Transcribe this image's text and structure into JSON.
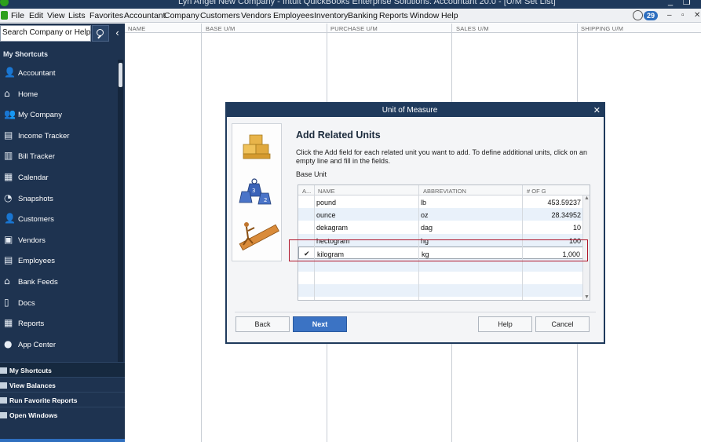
{
  "window": {
    "title": "Lyn Angel New Company  - Intuit QuickBooks Enterprise Solutions: Accountant 20.0 - [U/M Set List]"
  },
  "menu": {
    "items": [
      "File",
      "Edit",
      "View",
      "Lists",
      "Favorites",
      "Accountant",
      "Company",
      "Customers",
      "Vendors",
      "Employees",
      "Inventory",
      "Banking",
      "Reports",
      "Window",
      "Help"
    ],
    "reminder_count": "29"
  },
  "sidebar": {
    "search_placeholder": "Search Company or Help",
    "shortcuts_title": "My Shortcuts",
    "items": [
      {
        "label": "Accountant",
        "icon": "accountant-icon"
      },
      {
        "label": "Home",
        "icon": "home-icon"
      },
      {
        "label": "My Company",
        "icon": "company-icon"
      },
      {
        "label": "Income Tracker",
        "icon": "income-tracker-icon"
      },
      {
        "label": "Bill Tracker",
        "icon": "bill-tracker-icon"
      },
      {
        "label": "Calendar",
        "icon": "calendar-icon"
      },
      {
        "label": "Snapshots",
        "icon": "snapshots-icon"
      },
      {
        "label": "Customers",
        "icon": "customers-icon"
      },
      {
        "label": "Vendors",
        "icon": "vendors-icon"
      },
      {
        "label": "Employees",
        "icon": "employees-icon"
      },
      {
        "label": "Bank Feeds",
        "icon": "bank-icon"
      },
      {
        "label": "Docs",
        "icon": "docs-icon"
      },
      {
        "label": "Reports",
        "icon": "reports-icon"
      },
      {
        "label": "App Center",
        "icon": "app-center-icon"
      }
    ],
    "bottom_items": [
      "My Shortcuts",
      "View Balances",
      "Run Favorite Reports",
      "Open Windows"
    ]
  },
  "list": {
    "columns": [
      "NAME",
      "BASE U/M",
      "PURCHASE U/M",
      "SALES U/M",
      "SHIPPING U/M"
    ]
  },
  "dialog": {
    "title": "Unit of Measure",
    "heading": "Add Related Units",
    "description": "Click the Add field for each related unit you want to add. To define additional units, click on an empty line and fill in the fields.",
    "base_unit_label": "Base Unit",
    "grid": {
      "headers": {
        "add": "A...",
        "name": "NAME",
        "abbr": "ABBREVIATION",
        "qty": "# OF G"
      },
      "rows": [
        {
          "name": "pound",
          "abbr": "lb",
          "qty": "453.59237",
          "checked": false
        },
        {
          "name": "ounce",
          "abbr": "oz",
          "qty": "28.34952",
          "checked": false
        },
        {
          "name": "dekagram",
          "abbr": "dag",
          "qty": "10",
          "checked": false
        },
        {
          "name": "hectogram",
          "abbr": "hg",
          "qty": "100",
          "checked": false
        },
        {
          "name": "kilogram",
          "abbr": "kg",
          "qty": "1,000",
          "checked": true
        }
      ],
      "checkmark": "✔"
    },
    "buttons": {
      "back": "Back",
      "next": "Next",
      "help": "Help",
      "cancel": "Cancel"
    },
    "colors": {
      "highlight": "#b0152a",
      "primary": "#3b73c4",
      "titlebar": "#1f3a5c"
    }
  }
}
